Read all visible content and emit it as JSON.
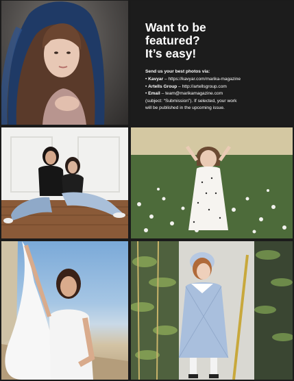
{
  "colors": {
    "background": "#1b1b1b",
    "panel": "#1c1c1c",
    "text": "#ffffff"
  },
  "info": {
    "headline": [
      "Want to be",
      "featured?",
      "It’s easy!"
    ],
    "lead": "Send us your best photos via:",
    "items": [
      {
        "bullet": "•",
        "name": "Kavyar",
        "text": " – https://kavyar.com/marika-magazine"
      },
      {
        "bullet": "•",
        "name": "Artells Group",
        "text": " – http://artellsgroup.com"
      },
      {
        "bullet": "•",
        "name": "Email",
        "text": " – team@marikamagazine.com"
      }
    ],
    "note_lines": [
      "(subject: “Submission”). If selected, your work",
      "will be published in the upcoming issue."
    ]
  }
}
